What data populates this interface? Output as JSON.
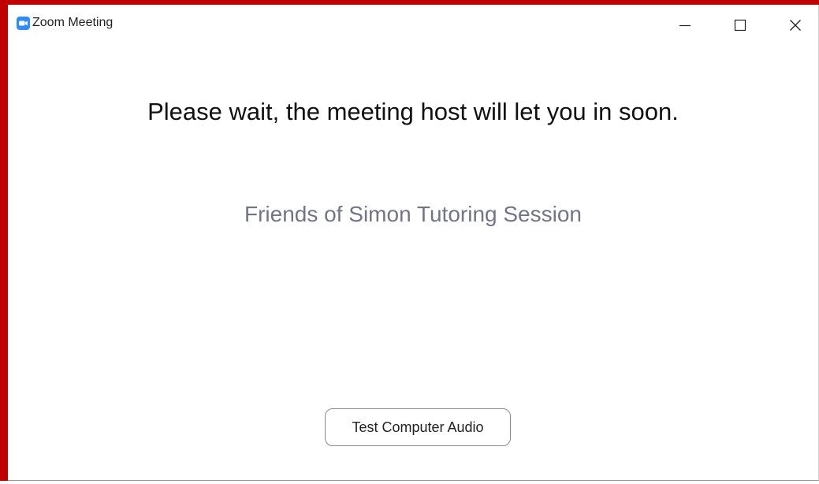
{
  "window": {
    "title": "Zoom Meeting",
    "app_icon": "zoom-camera-icon",
    "controls": {
      "minimize_icon": "minimize-icon",
      "maximize_icon": "maximize-icon",
      "close_icon": "close-icon"
    }
  },
  "main": {
    "wait_message": "Please wait, the meeting host will let you in soon.",
    "meeting_topic": "Friends of Simon Tutoring Session",
    "test_audio_label": "Test Computer Audio"
  },
  "colors": {
    "accent": "#2d8cff",
    "frame_border": "#c00000",
    "topic_text": "#747487"
  }
}
